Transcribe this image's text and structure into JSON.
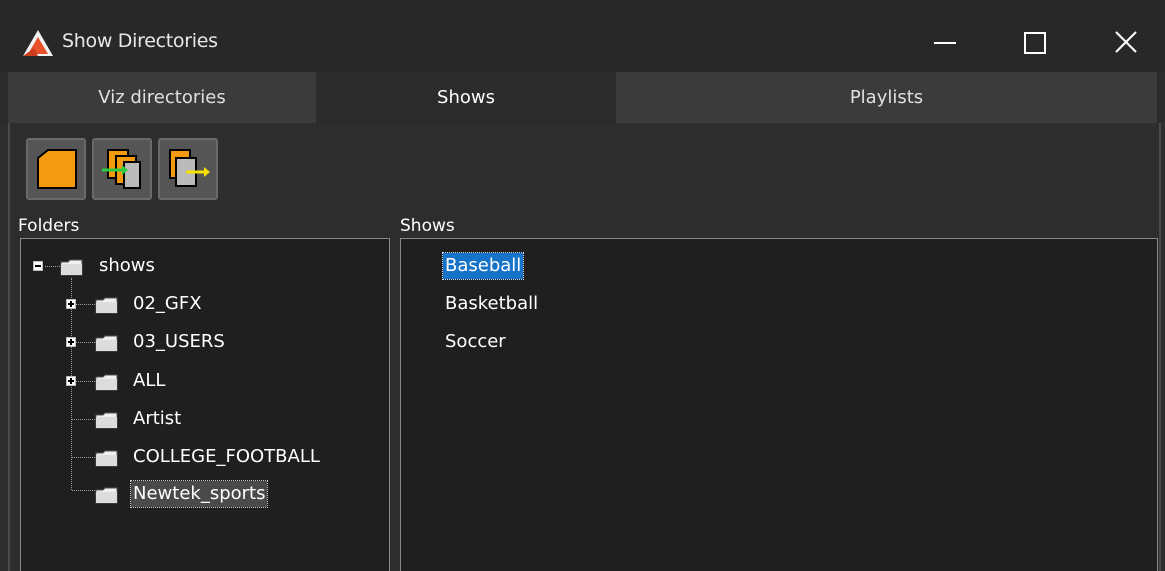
{
  "window": {
    "title": "Show Directories",
    "icon": "app-logo-icon",
    "controls": [
      "minimize-icon",
      "maximize-icon",
      "close-icon"
    ]
  },
  "tabs": [
    {
      "label": "Viz directories",
      "active": false
    },
    {
      "label": "Shows",
      "active": true
    },
    {
      "label": "Playlists",
      "active": false
    }
  ],
  "toolbar": {
    "buttons": [
      "new-folder-icon",
      "import-icon",
      "export-icon"
    ]
  },
  "folders": {
    "label": "Folders",
    "root": "shows",
    "items": [
      {
        "label": "02_GFX",
        "expandable": true
      },
      {
        "label": "03_USERS",
        "expandable": true
      },
      {
        "label": "ALL",
        "expandable": true
      },
      {
        "label": "Artist",
        "expandable": false
      },
      {
        "label": "COLLEGE_FOOTBALL",
        "expandable": false
      },
      {
        "label": "Newtek_sports",
        "expandable": false,
        "selected": true
      }
    ]
  },
  "shows": {
    "label": "Shows",
    "items": [
      {
        "label": "Baseball",
        "selected": true
      },
      {
        "label": "Basketball",
        "selected": false
      },
      {
        "label": "Soccer",
        "selected": false
      }
    ]
  },
  "colors": {
    "selection": "#1673c8",
    "folder_button": "#f39a11",
    "titlebar": "#282828"
  }
}
